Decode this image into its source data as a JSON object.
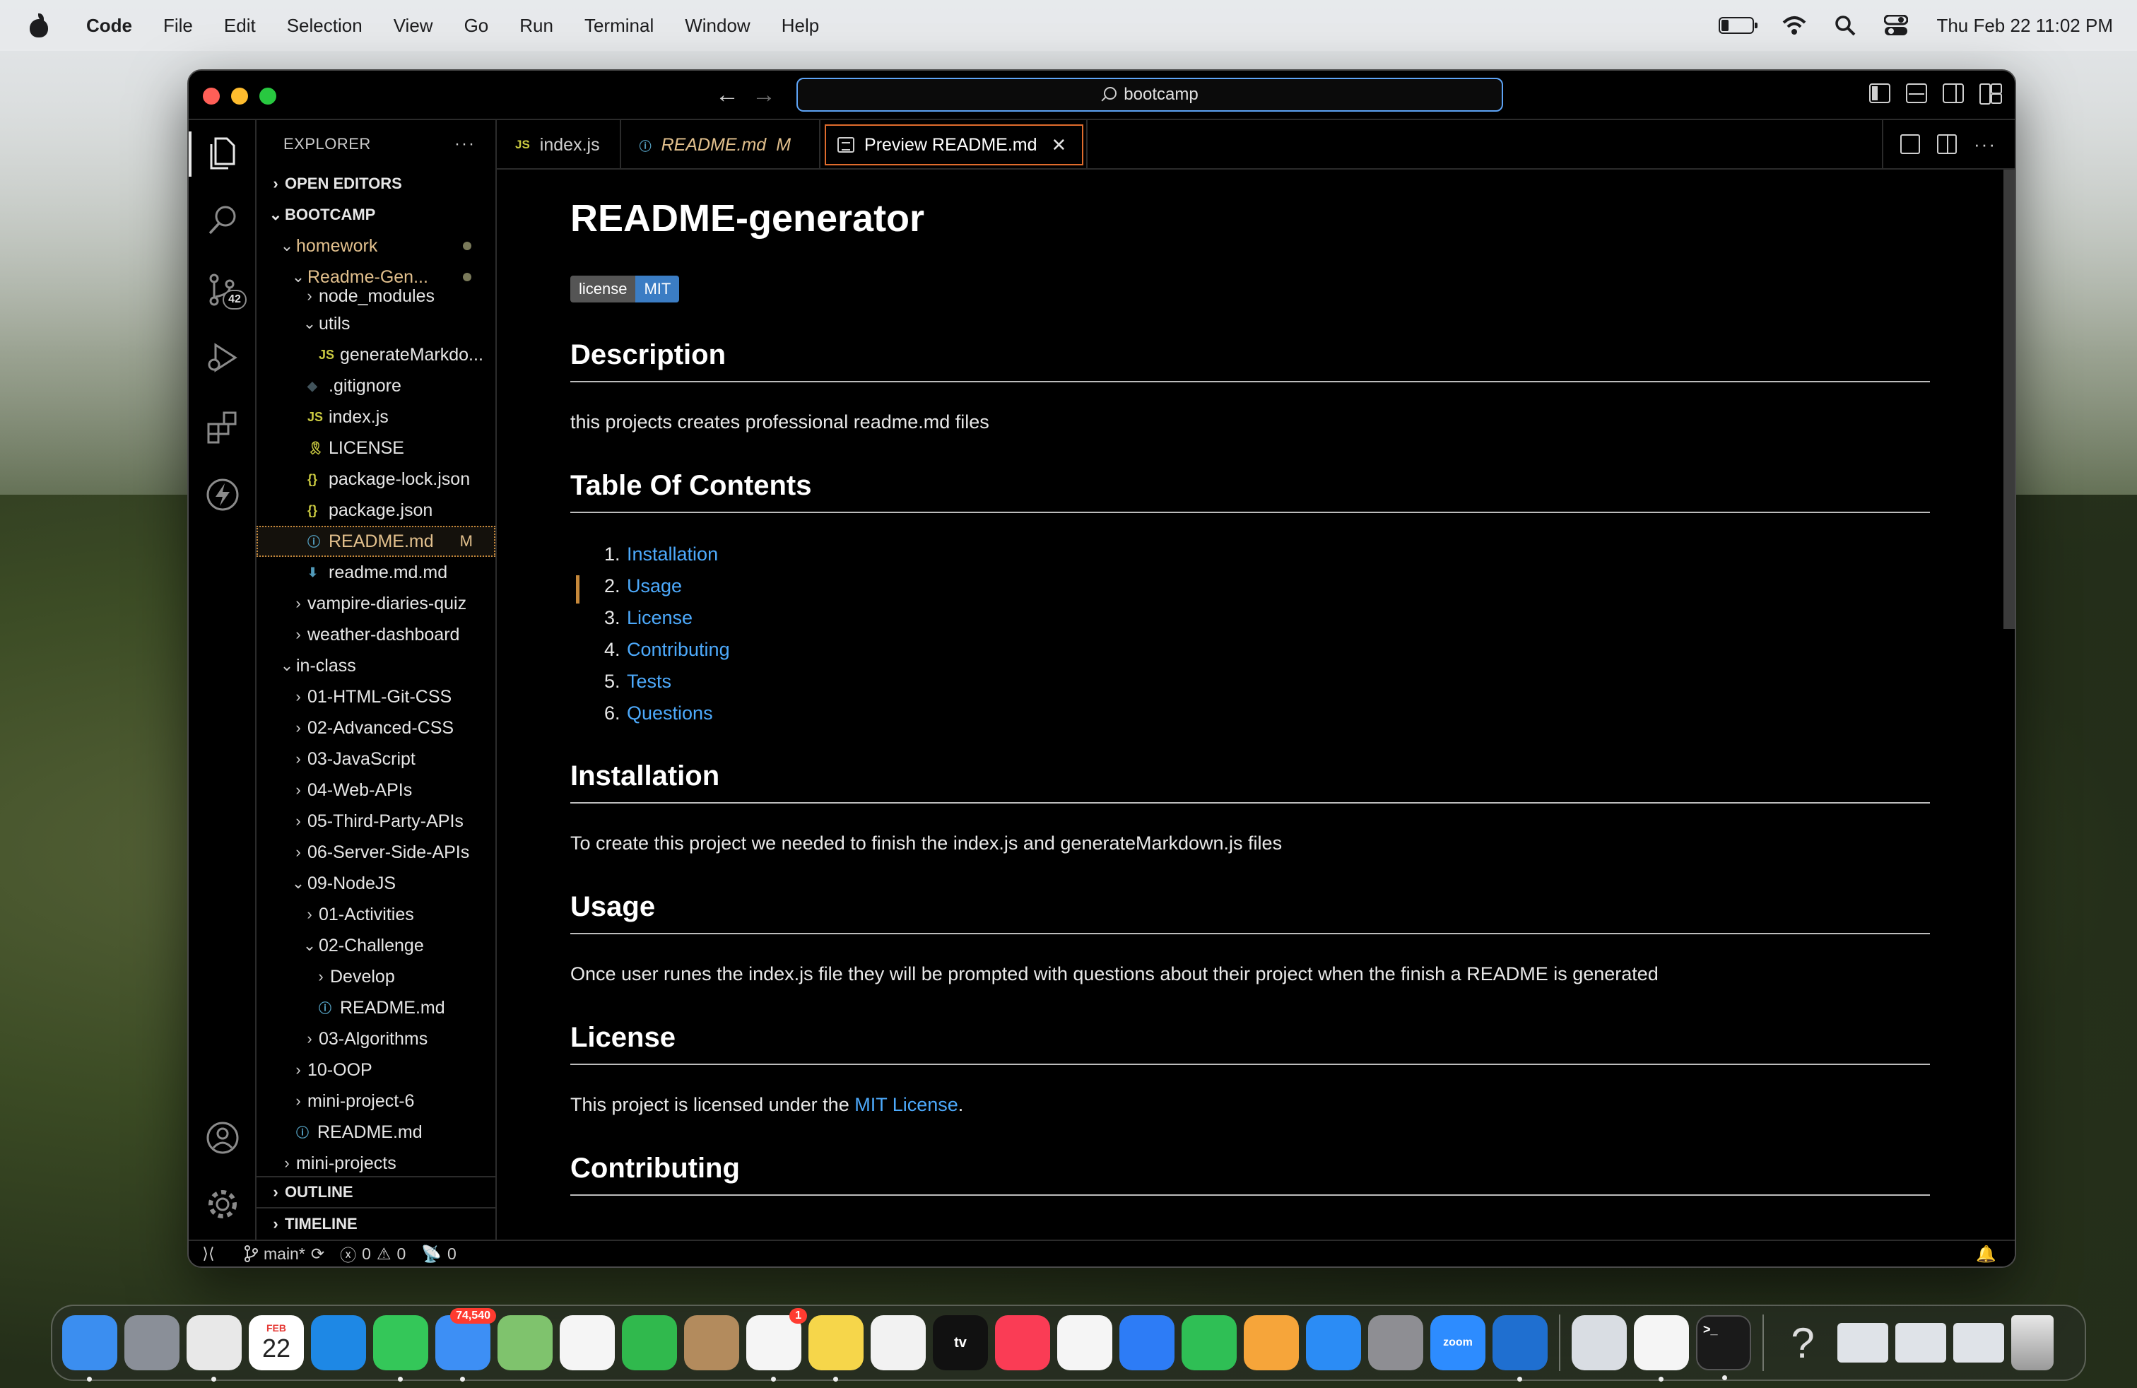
{
  "menubar": {
    "app_name": "Code",
    "menus": [
      "File",
      "Edit",
      "Selection",
      "View",
      "Go",
      "Run",
      "Terminal",
      "Window",
      "Help"
    ],
    "clock": "Thu Feb 22  11:02 PM"
  },
  "window": {
    "command_center_text": "bootcamp"
  },
  "activity_bar": {
    "scm_badge": "42"
  },
  "sidebar": {
    "title": "EXPLORER",
    "more": "···",
    "sections": {
      "open_editors": "OPEN EDITORS",
      "workspace": "BOOTCAMP",
      "outline": "OUTLINE",
      "timeline": "TIMELINE"
    },
    "tree": [
      {
        "label": "homework",
        "depth": 1,
        "chevron": "open",
        "icon": "",
        "modified": true,
        "dot": true
      },
      {
        "label": "Readme-Gen...",
        "depth": 2,
        "chevron": "open",
        "icon": "",
        "modified": true,
        "dot": true
      },
      {
        "label": "node_modules",
        "depth": 3,
        "chevron": "closed",
        "icon": ""
      },
      {
        "label": "utils",
        "depth": 3,
        "chevron": "open",
        "icon": ""
      },
      {
        "label": "generateMarkdo...",
        "depth": 4,
        "chevron": "",
        "icon": "JS"
      },
      {
        "label": ".gitignore",
        "depth": 3,
        "chevron": "",
        "icon": "◆"
      },
      {
        "label": "index.js",
        "depth": 3,
        "chevron": "",
        "icon": "JS"
      },
      {
        "label": "LICENSE",
        "depth": 3,
        "chevron": "",
        "icon": "🎗"
      },
      {
        "label": "package-lock.json",
        "depth": 3,
        "chevron": "",
        "icon": "{}"
      },
      {
        "label": "package.json",
        "depth": 3,
        "chevron": "",
        "icon": "{}"
      },
      {
        "label": "README.md",
        "depth": 3,
        "chevron": "",
        "icon": "ⓘ",
        "modified": true,
        "badge": "M",
        "selected": true
      },
      {
        "label": "readme.md.md",
        "depth": 3,
        "chevron": "",
        "icon": "⬇"
      },
      {
        "label": "vampire-diaries-quiz",
        "depth": 2,
        "chevron": "closed",
        "icon": ""
      },
      {
        "label": "weather-dashboard",
        "depth": 2,
        "chevron": "closed",
        "icon": ""
      },
      {
        "label": "in-class",
        "depth": 1,
        "chevron": "open",
        "icon": ""
      },
      {
        "label": "01-HTML-Git-CSS",
        "depth": 2,
        "chevron": "closed",
        "icon": ""
      },
      {
        "label": "02-Advanced-CSS",
        "depth": 2,
        "chevron": "closed",
        "icon": ""
      },
      {
        "label": "03-JavaScript",
        "depth": 2,
        "chevron": "closed",
        "icon": ""
      },
      {
        "label": "04-Web-APIs",
        "depth": 2,
        "chevron": "closed",
        "icon": ""
      },
      {
        "label": "05-Third-Party-APIs",
        "depth": 2,
        "chevron": "closed",
        "icon": ""
      },
      {
        "label": "06-Server-Side-APIs",
        "depth": 2,
        "chevron": "closed",
        "icon": ""
      },
      {
        "label": "09-NodeJS",
        "depth": 2,
        "chevron": "open",
        "icon": ""
      },
      {
        "label": "01-Activities",
        "depth": 3,
        "chevron": "closed",
        "icon": ""
      },
      {
        "label": "02-Challenge",
        "depth": 3,
        "chevron": "open",
        "icon": ""
      },
      {
        "label": "Develop",
        "depth": 4,
        "chevron": "closed",
        "icon": ""
      },
      {
        "label": "README.md",
        "depth": 4,
        "chevron": "",
        "icon": "ⓘ"
      },
      {
        "label": "03-Algorithms",
        "depth": 3,
        "chevron": "closed",
        "icon": ""
      },
      {
        "label": "10-OOP",
        "depth": 2,
        "chevron": "closed",
        "icon": ""
      },
      {
        "label": "mini-project-6",
        "depth": 2,
        "chevron": "closed",
        "icon": ""
      },
      {
        "label": "README.md",
        "depth": 2,
        "chevron": "",
        "icon": "ⓘ"
      },
      {
        "label": "mini-projects",
        "depth": 1,
        "chevron": "closed",
        "icon": ""
      }
    ]
  },
  "tabs": [
    {
      "label": "index.js",
      "icon": "JS",
      "modified_mark": "",
      "style": "normal"
    },
    {
      "label": "README.md",
      "icon": "ⓘ",
      "modified_mark": "M",
      "style": "italic"
    },
    {
      "label": "Preview README.md",
      "icon": "preview",
      "modified_mark": "",
      "style": "active",
      "close": "✕"
    }
  ],
  "preview": {
    "title": "README-generator",
    "badge": {
      "left": "license",
      "right": "MIT"
    },
    "sections": [
      {
        "heading": "Description",
        "text": "this projects creates professional readme.md files"
      },
      {
        "heading": "Table Of Contents"
      },
      {
        "heading": "Installation",
        "text": "To create this project we needed to finish the index.js and generateMarkdown.js files"
      },
      {
        "heading": "Usage",
        "text": "Once user runes the index.js file they will be prompted with questions about their project when the finish a README is generated"
      },
      {
        "heading": "License",
        "text_before": "This project is licensed under the ",
        "link": "MIT License",
        "text_after": "."
      },
      {
        "heading": "Contributing"
      }
    ],
    "toc": [
      {
        "num": "1.",
        "label": "Installation"
      },
      {
        "num": "2.",
        "label": "Usage"
      },
      {
        "num": "3.",
        "label": "License"
      },
      {
        "num": "4.",
        "label": "Contributing"
      },
      {
        "num": "5.",
        "label": "Tests"
      },
      {
        "num": "6.",
        "label": "Questions"
      }
    ]
  },
  "statusbar": {
    "branch": "main*",
    "errors": "0",
    "warnings": "0",
    "ports": "0"
  },
  "dock": {
    "mail_badge": "74,540",
    "reminders_badge": "1",
    "calendar_month": "FEB",
    "calendar_day": "22",
    "apps": [
      {
        "name": "finder",
        "color": "#3b8ef0"
      },
      {
        "name": "launchpad",
        "color": "#8a8f98"
      },
      {
        "name": "chrome",
        "color": "#e8e8e8"
      },
      {
        "name": "calendar",
        "color": "#ffffff"
      },
      {
        "name": "safari",
        "color": "#1e88e5"
      },
      {
        "name": "messages",
        "color": "#34c759"
      },
      {
        "name": "mail",
        "color": "#3d8ff5"
      },
      {
        "name": "maps",
        "color": "#7fc36d"
      },
      {
        "name": "photos",
        "color": "#f5f5f5"
      },
      {
        "name": "facetime",
        "color": "#30b94d"
      },
      {
        "name": "contacts",
        "color": "#b38b5d"
      },
      {
        "name": "reminders",
        "color": "#f5f5f5"
      },
      {
        "name": "notes",
        "color": "#f6d64a"
      },
      {
        "name": "freeform",
        "color": "#f2f2f2"
      },
      {
        "name": "tv",
        "color": "#111111"
      },
      {
        "name": "music",
        "color": "#fa3c55"
      },
      {
        "name": "news",
        "color": "#f5f5f5"
      },
      {
        "name": "keynote",
        "color": "#2d7cf6"
      },
      {
        "name": "numbers",
        "color": "#2fbf55"
      },
      {
        "name": "pages",
        "color": "#f6a53a"
      },
      {
        "name": "app-store",
        "color": "#2b8cf5"
      },
      {
        "name": "system-settings",
        "color": "#8e8e93"
      },
      {
        "name": "zoom",
        "color": "#2d8cff"
      },
      {
        "name": "vscode",
        "color": "#1f6fd0"
      }
    ],
    "apps_right": [
      {
        "name": "preview",
        "color": "#d9dde3"
      },
      {
        "name": "slack",
        "color": "#f5f5f5"
      },
      {
        "name": "terminal",
        "color": "#1a1a1a"
      }
    ],
    "tv_label": "tv",
    "zoom_label": "zoom",
    "terminal_label": ">_",
    "help_label": "?"
  }
}
